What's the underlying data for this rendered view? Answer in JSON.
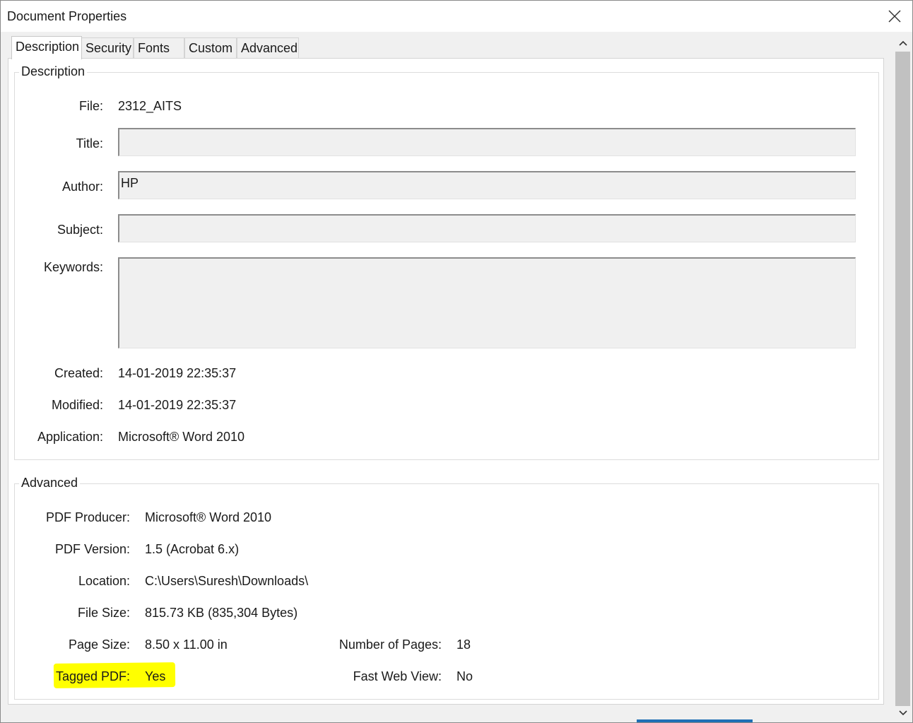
{
  "window": {
    "title": "Document Properties"
  },
  "tabs": [
    {
      "label": "Description"
    },
    {
      "label": "Security"
    },
    {
      "label": "Fonts"
    },
    {
      "label": "Custom"
    },
    {
      "label": "Advanced"
    }
  ],
  "description": {
    "legend": "Description",
    "file_label": "File:",
    "file_value": "2312_AITS",
    "title_label": "Title:",
    "title_value": "",
    "author_label": "Author:",
    "author_value": "HP",
    "subject_label": "Subject:",
    "subject_value": "",
    "keywords_label": "Keywords:",
    "keywords_value": "",
    "created_label": "Created:",
    "created_value": "14-01-2019 22:35:37",
    "modified_label": "Modified:",
    "modified_value": "14-01-2019 22:35:37",
    "application_label": "Application:",
    "application_value": "Microsoft® Word 2010"
  },
  "advanced": {
    "legend": "Advanced",
    "producer_label": "PDF Producer:",
    "producer_value": "Microsoft® Word 2010",
    "version_label": "PDF Version:",
    "version_value": "1.5 (Acrobat 6.x)",
    "location_label": "Location:",
    "location_value": "C:\\Users\\Suresh\\Downloads\\",
    "filesize_label": "File Size:",
    "filesize_value": "815.73 KB (835,304 Bytes)",
    "pagesize_label": "Page Size:",
    "pagesize_value": "8.50 x 11.00 in",
    "numpages_label": "Number of Pages:",
    "numpages_value": "18",
    "tagged_label": "Tagged PDF:",
    "tagged_value": "Yes",
    "fastweb_label": "Fast Web View:",
    "fastweb_value": "No"
  },
  "colors": {
    "highlight": "#ffff00",
    "accent": "#1f6fb5"
  },
  "icons": {
    "close": "close-icon",
    "scroll_up": "chevron-up-icon",
    "scroll_down": "chevron-down-icon"
  }
}
